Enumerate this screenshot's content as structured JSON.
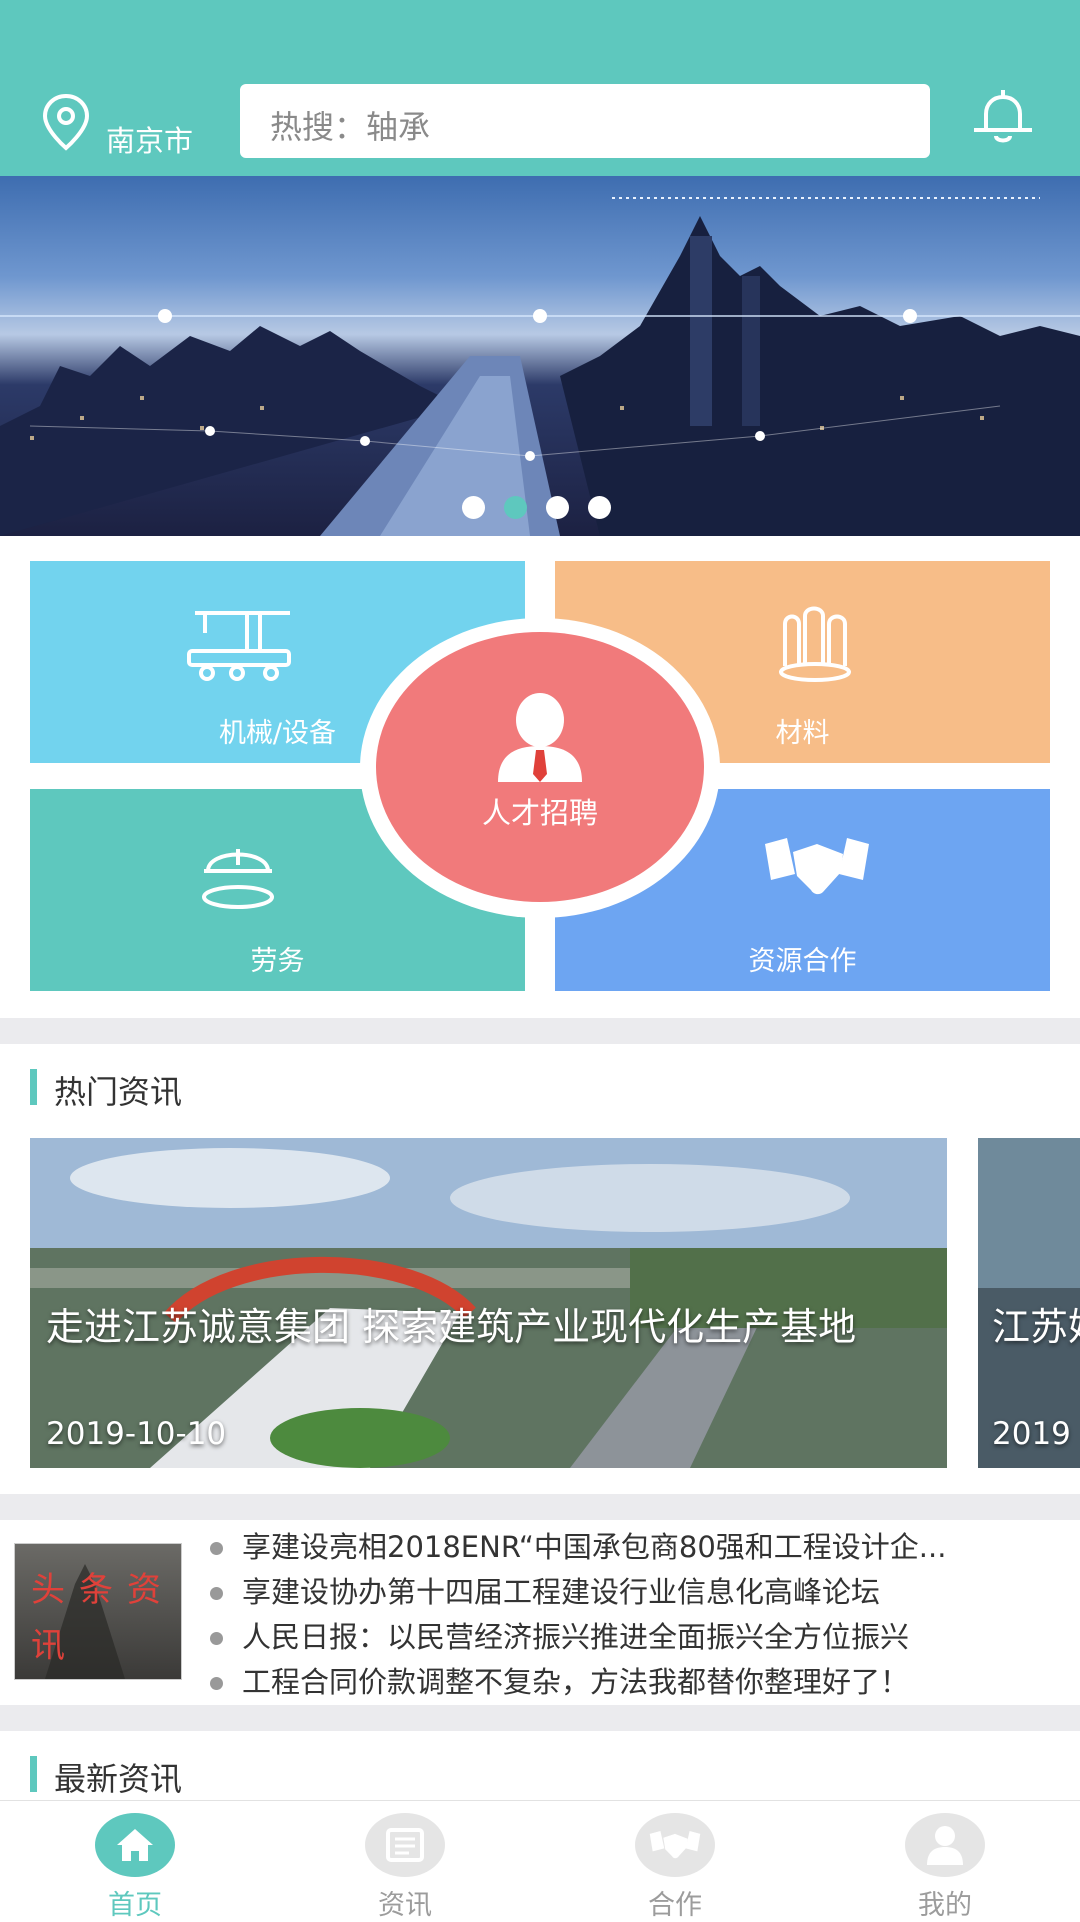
{
  "header": {
    "city": "南京市",
    "search_placeholder": "热搜：轴承",
    "accent": "#5ec8be"
  },
  "banner": {
    "slides": 4,
    "active_slide": 2
  },
  "categories": {
    "machinery": "机械/设备",
    "materials": "材料",
    "labor": "劳务",
    "recruit": "人才招聘",
    "cooperation": "资源合作"
  },
  "hot_news": {
    "title": "热门资讯",
    "cards": [
      {
        "title": "走进江苏诚意集团 探索建筑产业现代化生产基地",
        "date": "2019-10-10"
      },
      {
        "title": "江苏姓安",
        "date": "2019"
      }
    ]
  },
  "headlines": {
    "badge": "头条资讯",
    "items": [
      "享建设亮相2018ENR“中国承包商80强和工程设计企...",
      "享建设协办第十四届工程建设行业信息化高峰论坛",
      "人民日报：以民营经济振兴推进全面振兴全方位振兴",
      "工程合同价款调整不复杂，方法我都替你整理好了！"
    ]
  },
  "latest_news": {
    "title": "最新资讯"
  },
  "tabbar": {
    "items": [
      {
        "label": "首页",
        "icon": "home-icon",
        "active": true
      },
      {
        "label": "资讯",
        "icon": "news-icon",
        "active": false
      },
      {
        "label": "合作",
        "icon": "handshake-icon",
        "active": false
      },
      {
        "label": "我的",
        "icon": "user-icon",
        "active": false
      }
    ]
  }
}
